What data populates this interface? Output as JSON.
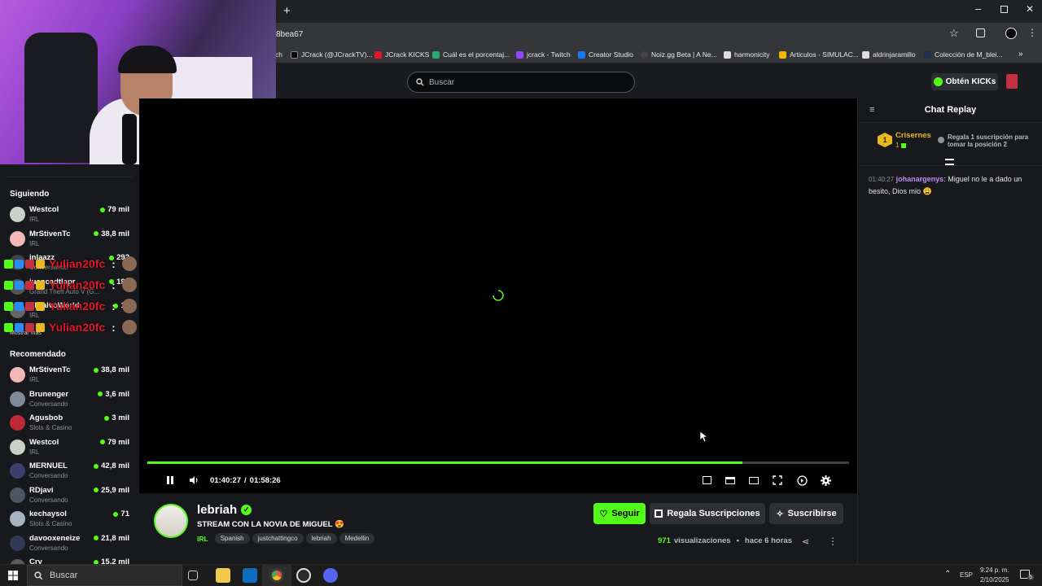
{
  "browser": {
    "url_fragment": "8bea67",
    "bookmarks": [
      {
        "label": "ch",
        "color": "#202124"
      },
      {
        "label": "JCrack (@JCrackTV)...",
        "color": "#000000"
      },
      {
        "label": "JCrack KICKS",
        "color": "#53fc18"
      },
      {
        "label": "Cuál es el porcentaj...",
        "color": "#2aa87a"
      },
      {
        "label": "jcrack - Twitch",
        "color": "#9146ff"
      },
      {
        "label": "Creator Studio",
        "color": "#1877f2"
      },
      {
        "label": "Noiz.gg Beta | A Ne...",
        "color": "#444444"
      },
      {
        "label": "harmonicity",
        "color": "#dddddd"
      },
      {
        "label": "Articulos - SIMULAC...",
        "color": "#f4b400"
      },
      {
        "label": "aldrinjaramillo",
        "color": "#dddddd"
      },
      {
        "label": "Colección de M_blei...",
        "color": "#203050"
      }
    ]
  },
  "header": {
    "search_placeholder": "Buscar",
    "kicks_label": "Obtén KICKs"
  },
  "sidebar": {
    "following_title": "Siguiendo",
    "following": [
      {
        "name": "Westcol",
        "category": "IRL",
        "viewers": "79 mil",
        "color": "#c9d1c9"
      },
      {
        "name": "MrStivenTc",
        "category": "IRL",
        "viewers": "38,8 mil",
        "color": "#f1b8b8"
      },
      {
        "name": "jnlaazz",
        "category": "Conversando",
        "viewers": "292",
        "color": "#444"
      },
      {
        "name": "juancadtlapr",
        "category": "Grand Theft Auto V (G...",
        "viewers": "192",
        "color": "#555"
      },
      {
        "name": "ElCalvoWorld",
        "category": "IRL",
        "viewers": "18",
        "color": "#666"
      }
    ],
    "show_more": "Mostrar más",
    "recommended_title": "Recomendado",
    "recommended": [
      {
        "name": "MrStivenTc",
        "category": "IRL",
        "viewers": "38,8 mil",
        "color": "#f1b8b8"
      },
      {
        "name": "Brunenger",
        "category": "Conversando",
        "viewers": "3,6 mil",
        "color": "#7d8a99"
      },
      {
        "name": "Agusbob",
        "category": "Slots & Casino",
        "viewers": "3 mil",
        "color": "#c0283a"
      },
      {
        "name": "Westcol",
        "category": "IRL",
        "viewers": "79 mil",
        "color": "#c9d1c9"
      },
      {
        "name": "MERNUEL",
        "category": "Conversando",
        "viewers": "42,8 mil",
        "color": "#3a3f6b"
      },
      {
        "name": "RDjavi",
        "category": "Conversando",
        "viewers": "25,9 mil",
        "color": "#4b5563"
      },
      {
        "name": "kechaysol",
        "category": "Slots & Casino",
        "viewers": "71",
        "color": "#a7b3c2"
      },
      {
        "name": "davooxeneize",
        "category": "Conversando",
        "viewers": "21,8 mil",
        "color": "#2f3a57"
      },
      {
        "name": "Cry",
        "category": "",
        "viewers": "15,2 mil",
        "color": "#5a5a5a"
      }
    ]
  },
  "overlay_chat": {
    "username": "Yulian20fc",
    "suffix": ":",
    "count": 4
  },
  "player": {
    "current_time": "01:40:27",
    "separator": "/",
    "duration": "01:58:26",
    "progress": 0.848
  },
  "chat": {
    "title": "Chat Replay",
    "top_gifter": {
      "rank": "1",
      "name": "Crisernes",
      "count": "1"
    },
    "gift_prompt": "Regala 1 suscripción para tomar la posición 2",
    "messages": [
      {
        "time": "01:40:27",
        "user": "johanargenys",
        "text": "Miguel no le a dado un besito, Dios mio 😩"
      }
    ]
  },
  "stream": {
    "channel": "lebriah",
    "title": "STREAM CON LA NOVIA DE MIGUEL 😍",
    "category": "IRL",
    "tags": [
      "Spanish",
      "justchattingco",
      "lebriah",
      "Medellin"
    ],
    "follow_label": "Seguir",
    "gift_label": "Regala Suscripciones",
    "subscribe_label": "Suscribirse",
    "views": "971",
    "views_label": "visualizaciones",
    "bullet": "•",
    "ago": "hace 6 horas"
  },
  "taskbar": {
    "search_label": "Buscar",
    "lang": "ESP",
    "time": "9:24 p. m.",
    "date": "2/10/2025",
    "notif_count": "5"
  },
  "colors": {
    "accent": "#53fc18",
    "bg": "#18191c",
    "chat_user": "#c58af9"
  }
}
